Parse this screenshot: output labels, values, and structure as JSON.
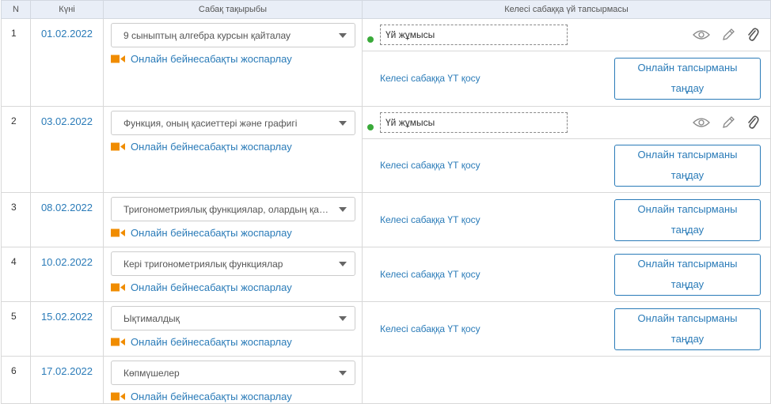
{
  "header": {
    "n": "N",
    "date": "Күні",
    "topic": "Сабақ тақырыбы",
    "homework": "Келесі сабаққа үй тапсырмасы"
  },
  "common": {
    "online_plan": "Онлайн бейнесабақты жоспарлау",
    "hw_label": "Үй жұмысы",
    "add_hw": "Келесі сабаққа ҮТ қосу",
    "choose_btn_line1": "Онлайн тапсырманы",
    "choose_btn_line2": "таңдау"
  },
  "rows": [
    {
      "n": "1",
      "date": "01.02.2022",
      "topic": "9 сыныптың алгебра курсын қайталау"
    },
    {
      "n": "2",
      "date": "03.02.2022",
      "topic": "Функция, оның қасиеттері және графигі"
    },
    {
      "n": "3",
      "date": "08.02.2022",
      "topic": "Тригонометриялық функциялар, олардың қасиеттері"
    },
    {
      "n": "4",
      "date": "10.02.2022",
      "topic": "Кері тригонометриялық функциялар"
    },
    {
      "n": "5",
      "date": "15.02.2022",
      "topic": "Ықтималдық"
    },
    {
      "n": "6",
      "date": "17.02.2022",
      "topic": "Көпмүшелер"
    }
  ],
  "colors": {
    "accent": "#2a7bb8",
    "camera": "#f08c00",
    "status": "#3aaa3a"
  }
}
